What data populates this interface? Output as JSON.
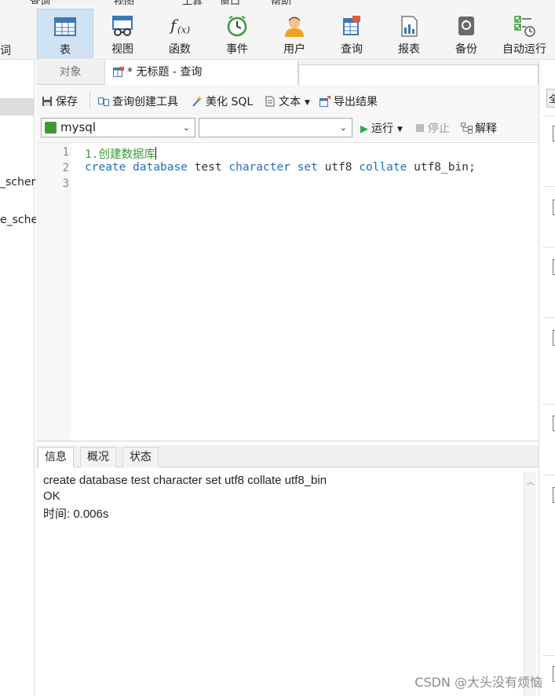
{
  "menu": [
    "查询",
    "视图",
    "工具",
    "窗口",
    "帮助"
  ],
  "toolbar": {
    "left_cut_label": "词",
    "buttons": [
      {
        "label": "表",
        "icon": "table-icon",
        "active": true
      },
      {
        "label": "视图",
        "icon": "view-icon",
        "active": false
      },
      {
        "label": "函数",
        "icon": "function-icon",
        "active": false
      },
      {
        "label": "事件",
        "icon": "event-clock-icon",
        "active": false
      },
      {
        "label": "用户",
        "icon": "user-icon",
        "active": false
      },
      {
        "label": "查询",
        "icon": "query-icon",
        "active": false
      },
      {
        "label": "报表",
        "icon": "report-icon",
        "active": false
      },
      {
        "label": "备份",
        "icon": "backup-icon",
        "active": false
      },
      {
        "label": "自动运行",
        "icon": "auto-run-icon",
        "active": false
      }
    ]
  },
  "left_panel": {
    "items": [
      "_scher",
      "e_sche"
    ]
  },
  "right_strip": {
    "tab_label": "全"
  },
  "tabs": {
    "objects_label": "对象",
    "query_label": "* 无标题 - 查询"
  },
  "query_toolbar": {
    "save": "保存",
    "query_builder": "查询创建工具",
    "beautify": "美化 SQL",
    "text": "文本",
    "export": "导出结果",
    "connection": "mysql",
    "database": "",
    "run": "运行",
    "stop": "停止",
    "explain": "解释"
  },
  "editor": {
    "line_numbers": [
      "1",
      "2",
      "3"
    ],
    "line1": "1.创建数据库",
    "line2": {
      "t1": "create",
      "t2": "database",
      "t3": "test",
      "t4": "character",
      "t5": "set",
      "t6": "utf8",
      "t7": "collate",
      "t8": "utf8_bin;"
    }
  },
  "result": {
    "tabs": [
      "信息",
      "概况",
      "状态"
    ],
    "lines": [
      "create database test character set utf8 collate utf8_bin",
      "OK",
      "时间: 0.006s"
    ]
  },
  "watermark": "CSDN @大头没有烦恼",
  "colors": {
    "keyword": "#1d6fc4",
    "comment": "#3a9a3a",
    "active_tab": "#cfe3f5"
  }
}
